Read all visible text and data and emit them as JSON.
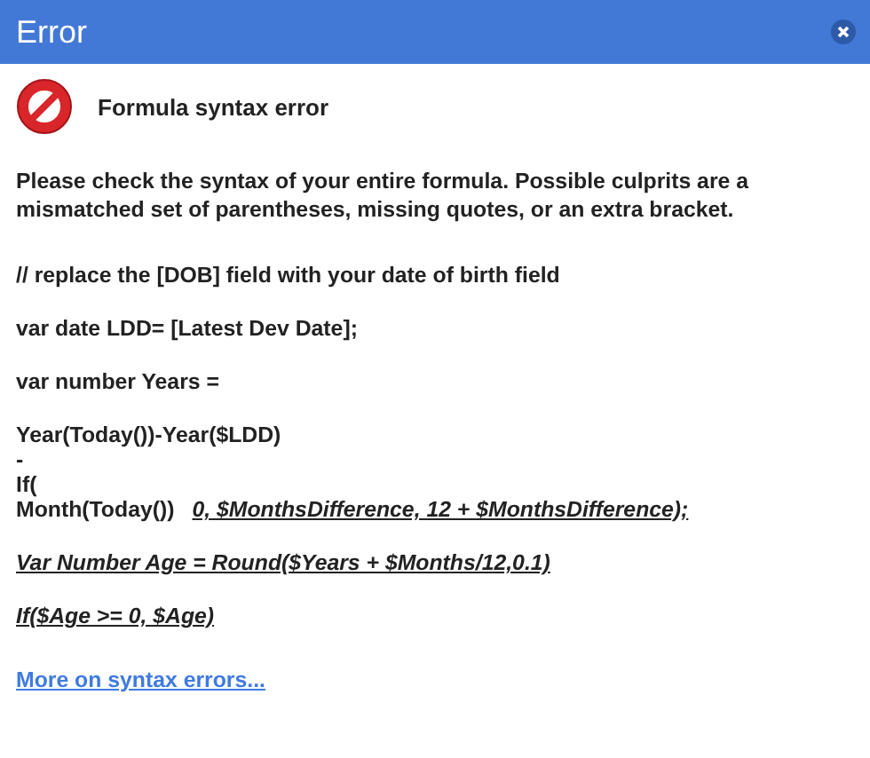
{
  "window": {
    "title": "Error"
  },
  "heading": "Formula syntax error",
  "message": "Please check the syntax of your entire formula. Possible culprits are a mismatched set of parentheses, missing quotes, or an extra bracket.",
  "code_paragraphs": [
    {
      "lines": [
        {
          "parts": [
            {
              "kind": "plain",
              "text": "// replace the [DOB] field with your date of birth field"
            }
          ]
        }
      ]
    },
    {
      "lines": [
        {
          "parts": [
            {
              "kind": "plain",
              "text": "var date LDD= [Latest Dev Date];"
            }
          ]
        }
      ]
    },
    {
      "lines": [
        {
          "parts": [
            {
              "kind": "plain",
              "text": "var number Years ="
            }
          ]
        }
      ]
    },
    {
      "lines": [
        {
          "parts": [
            {
              "kind": "plain",
              "text": "Year(Today())-Year($LDD)"
            }
          ]
        },
        {
          "parts": [
            {
              "kind": "plain",
              "text": "-"
            }
          ]
        },
        {
          "parts": [
            {
              "kind": "plain",
              "text": "If("
            }
          ]
        },
        {
          "parts": [
            {
              "kind": "plain",
              "text": "Month(Today())"
            },
            {
              "kind": "emphasis",
              "text": "0, $MonthsDifference, 12 + $MonthsDifference);"
            }
          ]
        }
      ]
    },
    {
      "lines": [
        {
          "parts": [
            {
              "kind": "emphasis",
              "text": "Var Number Age = Round($Years + $Months/12,0.1)"
            }
          ]
        }
      ]
    },
    {
      "lines": [
        {
          "parts": [
            {
              "kind": "emphasis",
              "text": "If($Age >= 0, $Age)"
            }
          ]
        }
      ]
    }
  ],
  "link": "More on syntax errors..."
}
